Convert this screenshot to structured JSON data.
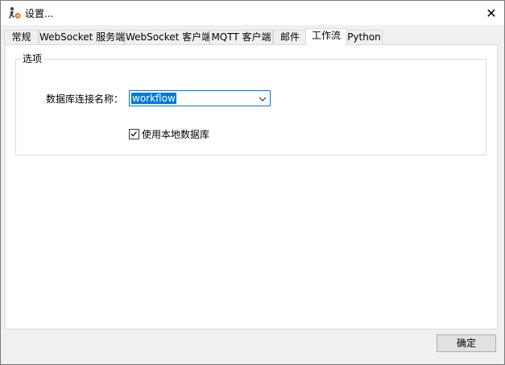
{
  "window": {
    "title": "设置...",
    "icon": "settings-gear-figure-icon",
    "close_glyph": "✕"
  },
  "tabs": [
    {
      "label": "常规",
      "active": false
    },
    {
      "label": "WebSocket 服务端",
      "active": false
    },
    {
      "label": "WebSocket 客户端",
      "active": false
    },
    {
      "label": "MQTT 客户端",
      "active": false
    },
    {
      "label": "邮件",
      "active": false
    },
    {
      "label": "工作流",
      "active": true
    },
    {
      "label": "Python",
      "active": false
    }
  ],
  "options_group": {
    "legend": "选项",
    "db_connection_label": "数据库连接名称：",
    "db_connection_value": "workflow",
    "use_local_db_label": "使用本地数据库",
    "use_local_db_checked": true
  },
  "footer": {
    "ok_label": "确定"
  },
  "colors": {
    "accent": "#0078d7",
    "tab_active_bg": "#ffffff",
    "window_bg": "#f0f0f0"
  }
}
